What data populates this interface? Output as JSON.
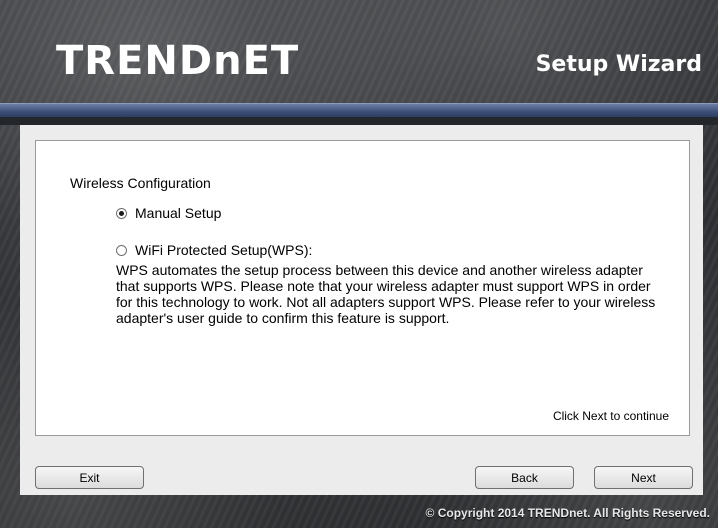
{
  "header": {
    "logo_text": "TRENDnET",
    "title": "Setup Wizard"
  },
  "wizard": {
    "section_title": "Wireless Configuration",
    "options": [
      {
        "label": "Manual Setup",
        "selected": true
      },
      {
        "label": "WiFi Protected Setup(WPS):",
        "selected": false
      }
    ],
    "wps_description": "WPS automates the setup process between this device and another wireless adapter that supports WPS. Please note that your wireless adapter must support WPS in order for this technology to work. Not all adapters support WPS. Please refer to your wireless adapter's user guide to confirm this feature is support.",
    "hint": "Click Next to continue"
  },
  "buttons": {
    "exit": "Exit",
    "back": "Back",
    "next": "Next"
  },
  "footer": {
    "copyright": "© Copyright 2014 TRENDnet. All Rights Reserved."
  },
  "colors": {
    "accent_stripe": "#3d4f78",
    "panel": "#ececec"
  }
}
